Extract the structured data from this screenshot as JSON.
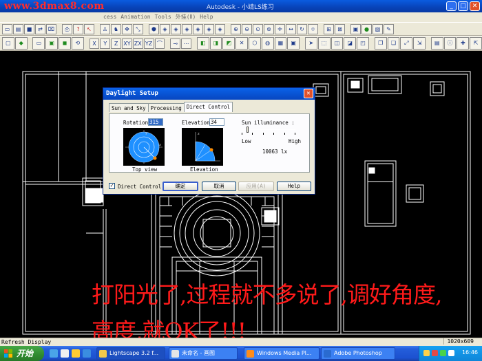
{
  "window": {
    "watermark": "www.3dmax8.com",
    "title": "Autodesk  - 小靖LS练习"
  },
  "menu": [
    "cess",
    "Animation",
    "Tools",
    "外挂(Ⅱ)",
    "Help"
  ],
  "dialog": {
    "title": "Daylight Setup",
    "tabs": [
      "Sun and Sky",
      "Processing",
      "Direct Control"
    ],
    "active_tab": "Direct Control",
    "rotation_label": "Rotation",
    "rotation_value": "315",
    "elevation_label": "Elevation",
    "elevation_value": "34",
    "top_view_caption": "Top view",
    "elevation_caption": "Elevation",
    "sun_illuminance_label": "Sun illuminance :",
    "low_label": "Low",
    "high_label": "High",
    "illuminance_value": "10063 lx",
    "direct_control_checkbox": "Direct Control",
    "direct_control_checked": true,
    "buttons": {
      "ok": "确定",
      "cancel": "取消",
      "apply": "应用(A)",
      "help": "Help"
    }
  },
  "overlay_text": {
    "line1": "打阳光了,过程就不多说了,调好角度,",
    "line2": "高度,就OK了!!!"
  },
  "status": {
    "left": "Refresh Display",
    "right": "1020x609"
  },
  "taskbar": {
    "start": "开始",
    "tasks": [
      "Lightscape 3.2 f...",
      "未命名 - 画图",
      "Windows Media Pl...",
      "Adobe Photoshop"
    ],
    "clock": "16:46"
  },
  "colors": {
    "overlay": "#ff1a1a",
    "watermark": "#ff2d2d",
    "preview_disc": "#1e90ff",
    "sun_marker": "#ff8c00"
  }
}
